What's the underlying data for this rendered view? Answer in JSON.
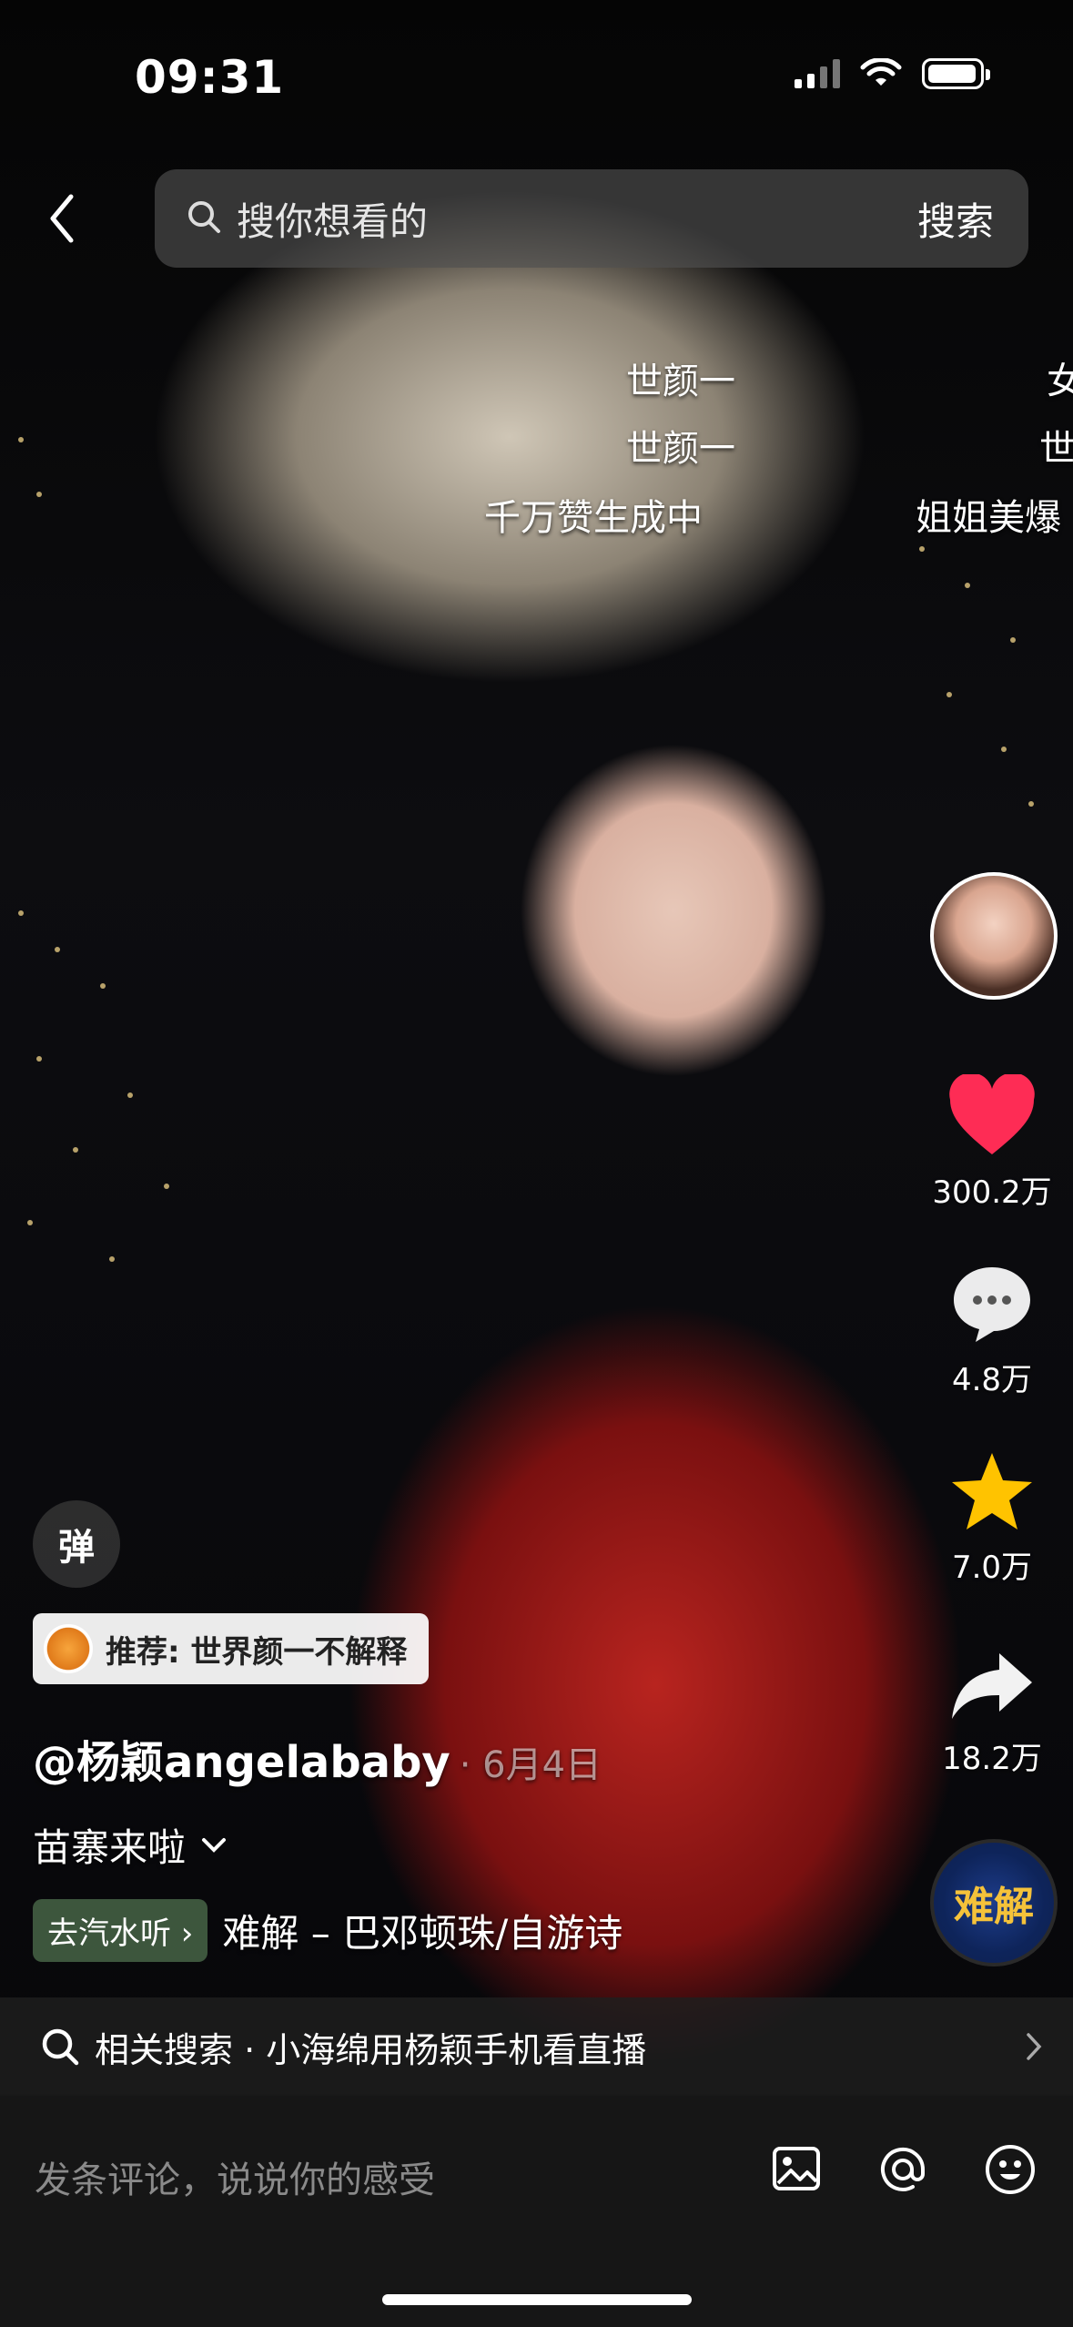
{
  "status_bar": {
    "time": "09:31"
  },
  "search": {
    "placeholder": "搜你想看的",
    "button": "搜索"
  },
  "danmaku": [
    "世颜一",
    "世颜一",
    "千万赞生成中",
    "女",
    "世",
    "姐姐美爆"
  ],
  "rail": {
    "likes": "300.2万",
    "comments": "4.8万",
    "favorites": "7.0万",
    "shares": "18.2万"
  },
  "music_disc_label": "难解",
  "danmu_button": "弹",
  "recommend": {
    "label": "推荐: 世界颜一不解释"
  },
  "author": {
    "handle": "@杨颖angelababy",
    "date": "· 6月4日"
  },
  "topic": "苗寨来啦",
  "music": {
    "tag": "去汽水听 ›",
    "title": "难解 – 巴邓顿珠/自游诗"
  },
  "related": {
    "text": "相关搜索 · 小海绵用杨颖手机看直播"
  },
  "comment": {
    "placeholder": "发条评论，说说你的感受"
  },
  "colors": {
    "like": "#fe2c55",
    "favorite": "#ffc300",
    "accent_bg": "#161616"
  }
}
